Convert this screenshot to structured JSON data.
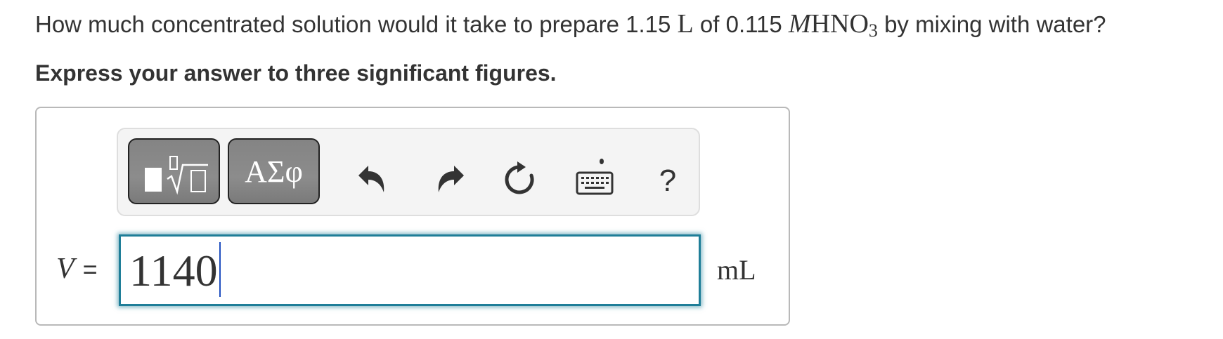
{
  "question": {
    "part1": "How much concentrated solution would it take to prepare 1.15",
    "volume_unit": "L",
    "part2": "of 0.115",
    "molarity_symbol": "M",
    "compound_main": "HNO",
    "compound_subscript": "3",
    "part3": "by mixing with water?"
  },
  "instruction": "Express your answer to three significant figures.",
  "toolbar": {
    "templates_icon": "templates-icon",
    "symbols_label": "ΑΣφ",
    "undo_icon": "undo-icon",
    "redo_icon": "redo-icon",
    "reset_icon": "reset-icon",
    "keyboard_icon": "keyboard-icon",
    "help_label": "?"
  },
  "answer": {
    "variable": "V",
    "equals": "=",
    "value": "1140",
    "unit": "mL"
  },
  "colors": {
    "input_border": "#1f7e98",
    "button_bg": "#8a8a8a",
    "text": "#333333"
  }
}
